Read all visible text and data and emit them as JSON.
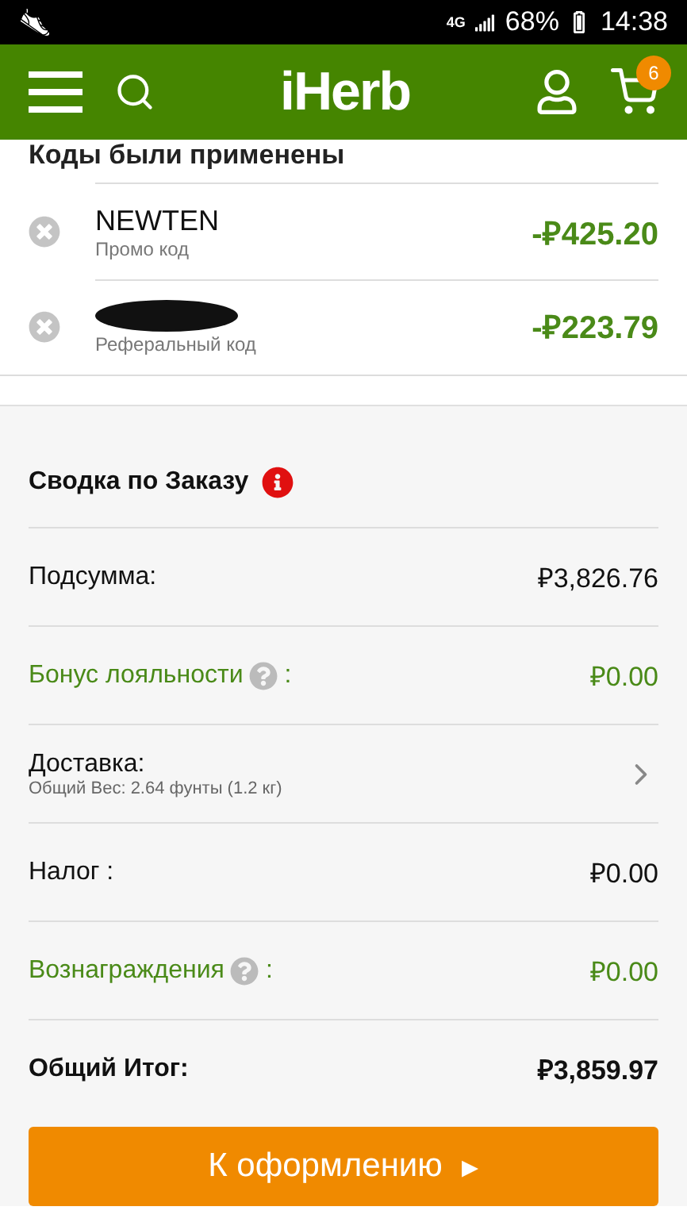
{
  "status_bar": {
    "network": "4G",
    "battery": "68%",
    "time": "14:38"
  },
  "header": {
    "logo": "iHerb",
    "cart_count": "6"
  },
  "codes": {
    "title": "Коды были применены",
    "items": [
      {
        "code": "NEWTEN",
        "type": "Промо код",
        "amount": "-₽425.20",
        "redacted": false
      },
      {
        "type": "Реферальный код",
        "amount": "-₽223.79",
        "redacted": true
      }
    ]
  },
  "summary": {
    "title": "Сводка по Заказу",
    "rows": [
      {
        "kind": "plain",
        "label": "Подсумма:",
        "value": "₽3,826.76"
      },
      {
        "kind": "green",
        "label": "Бонус лояльности",
        "suffix": ":",
        "value": "₽0.00"
      },
      {
        "kind": "detail",
        "label": "Доставка:",
        "note": "Общий Вес: 2.64 фунты (1.2 кг)"
      },
      {
        "kind": "plain",
        "label": "Налог :",
        "value": "₽0.00"
      },
      {
        "kind": "green",
        "label": "Вознаграждения",
        "suffix": ":",
        "value": "₽0.00"
      },
      {
        "kind": "total",
        "label": "Общий Итог:",
        "value": "₽3,859.97"
      }
    ]
  },
  "checkout_button": {
    "label": "К оформлению",
    "arrow": "▸"
  }
}
